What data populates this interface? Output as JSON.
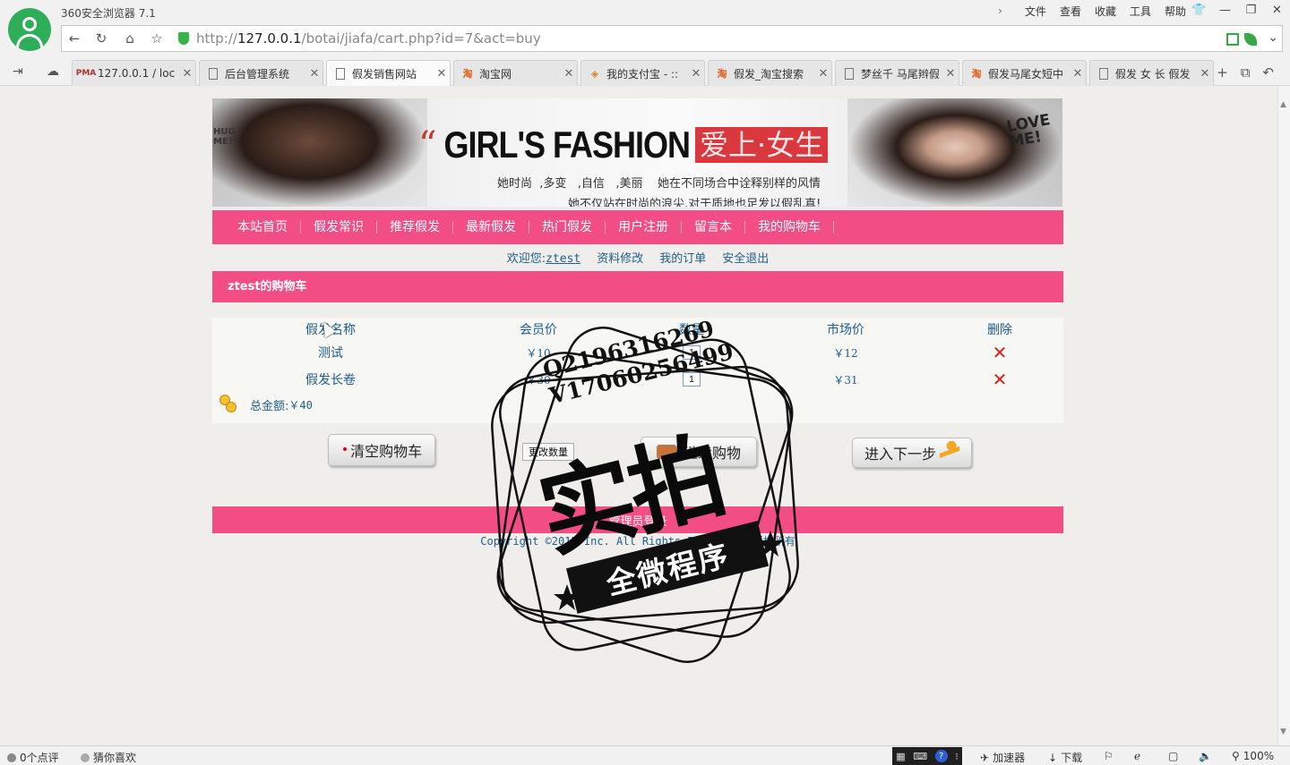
{
  "browser": {
    "app_title": "360安全浏览器 7.1",
    "menu": [
      "文件",
      "查看",
      "收藏",
      "工具",
      "帮助"
    ],
    "window_buttons": [
      "shirt-icon",
      "minimize-icon",
      "restore-icon",
      "close-icon"
    ],
    "url": {
      "scheme": "http://",
      "host": "127.0.0.1",
      "path": "/botai/jiafa/cart.php?id=7&act=buy"
    },
    "tabs": [
      {
        "label": "127.0.0.1 / loc",
        "icon": "pma-icon",
        "active": false
      },
      {
        "label": "后台管理系统",
        "icon": "page-icon",
        "active": false
      },
      {
        "label": "假发销售网站",
        "icon": "page-icon",
        "active": true
      },
      {
        "label": "淘宝网",
        "icon": "taobao-icon",
        "active": false
      },
      {
        "label": "我的支付宝 - ::",
        "icon": "alipay-icon",
        "active": false
      },
      {
        "label": "假发_淘宝搜索",
        "icon": "taobao-icon",
        "active": false
      },
      {
        "label": "梦丝千 马尾辫假",
        "icon": "page-icon",
        "active": false
      },
      {
        "label": "假发马尾女短中",
        "icon": "taobao-icon",
        "active": false
      },
      {
        "label": "假发 女 长 假发",
        "icon": "page-icon",
        "active": false
      }
    ]
  },
  "site": {
    "banner": {
      "hug_text": "HUG\nME?",
      "love_text": "LOVE\nME!",
      "title_en": "GIRL'S FASHION",
      "title_cn": "爱上·女生",
      "slogan1": "她时尚  ,多变   ,自信   ,美丽    她在不同场合中诠释别样的风情",
      "slogan2": "她不仅站在时尚的浪尖,对于质地也足发以假乱真!"
    },
    "nav": [
      "本站首页",
      "假发常识",
      "推荐假发",
      "最新假发",
      "热门假发",
      "用户注册",
      "留言本",
      "我的购物车"
    ],
    "user_bar": {
      "welcome_label": "欢迎您:",
      "username": "ztest",
      "links": [
        "资料修改",
        "我的订单",
        "安全退出"
      ]
    },
    "cart": {
      "title": "ztest的购物车",
      "columns": [
        "假发名称",
        "会员价",
        "数量",
        "市场价",
        "删除"
      ],
      "rows": [
        {
          "name": "测试",
          "member_price": "￥10",
          "qty": "1",
          "market_price": "￥12"
        },
        {
          "name": "假发长卷",
          "member_price": "￥30",
          "qty": "1",
          "market_price": "￥31"
        }
      ],
      "total_label": "总金额:",
      "total_value": "￥40"
    },
    "buttons": {
      "clear": "清空购物车",
      "update": "更改数量",
      "continue": "继续购物",
      "next": "进入下一步"
    },
    "footer": {
      "admin_login": "管理员登录",
      "copyright": "Copyright ©2015 Inc. All Rights Reserved. 版权所有"
    }
  },
  "watermark": {
    "contact_q": "Q2196316269",
    "contact_v": "V17060256499",
    "big_text": "实拍",
    "ribbon_text": "全微程序"
  },
  "statusbar": {
    "comments": "0个点评",
    "guess": "猜你喜欢",
    "accelerator": "加速器",
    "download": "下载",
    "zoom": "100%"
  },
  "colors": {
    "accent_pink": "#f24d84",
    "link_blue": "#1e5d8c",
    "delete_red": "#d4231c",
    "page_bg": "#efeeea"
  }
}
